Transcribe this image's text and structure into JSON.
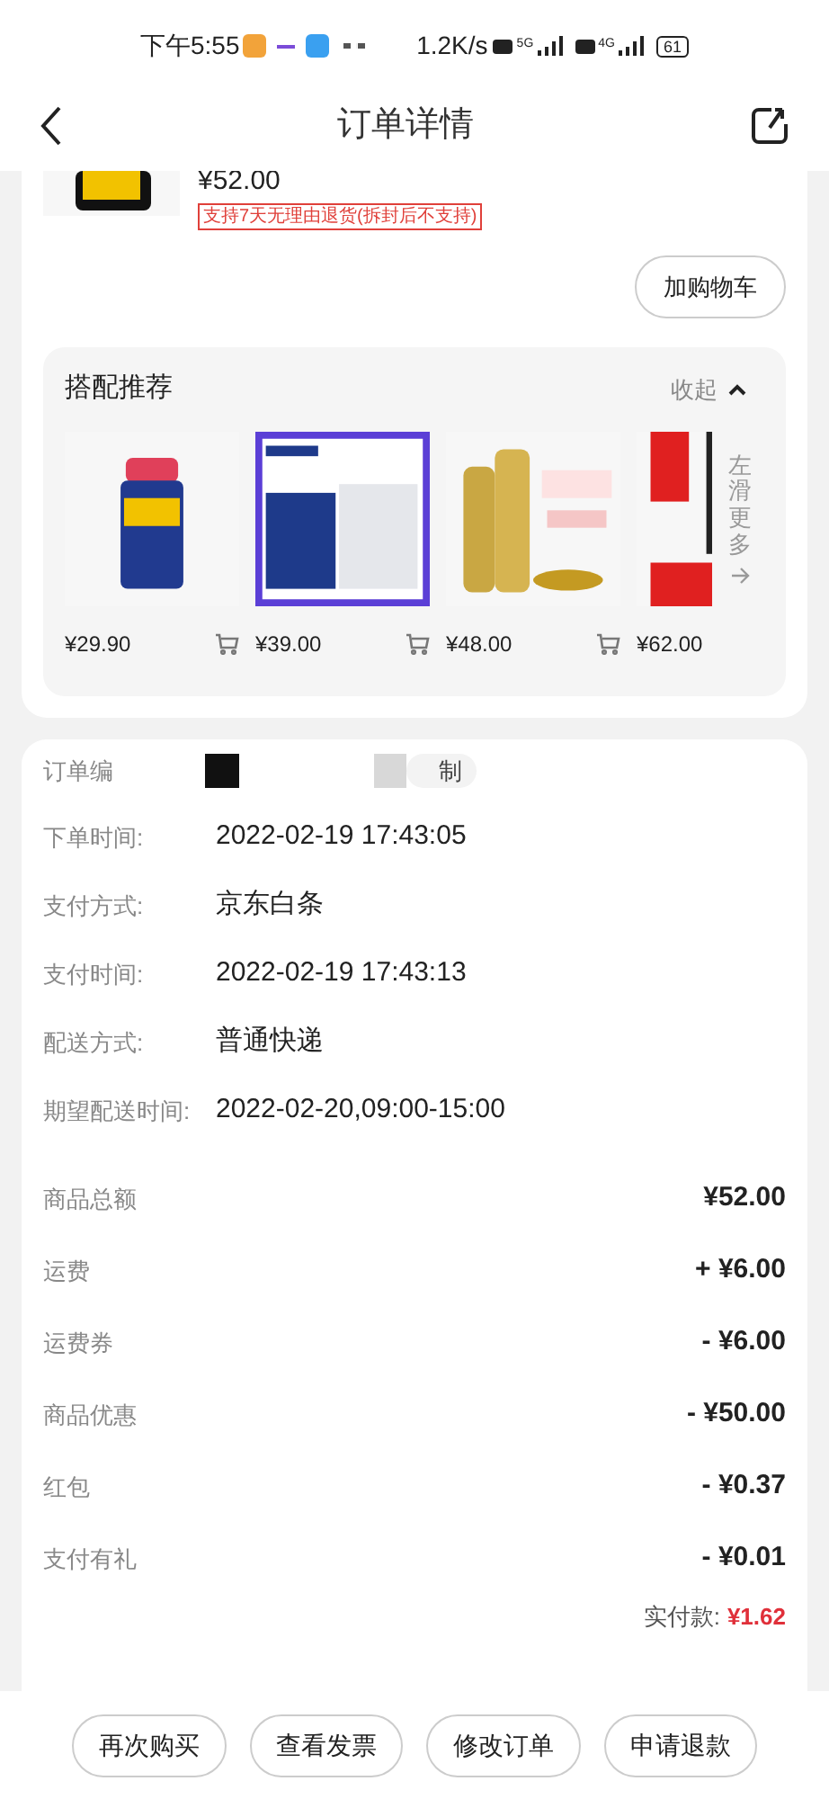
{
  "status_bar": {
    "time": "下午5:55",
    "speed": "1.2K/s",
    "network_1": "5G",
    "network_2": "4G",
    "battery": "61"
  },
  "header": {
    "title": "订单详情"
  },
  "product": {
    "price": "¥52.00",
    "return_policy": "支持7天无理由退货(拆封后不支持)",
    "add_to_cart": "加购物车"
  },
  "recommendations": {
    "title": "搭配推荐",
    "collapse": "收起",
    "more": "左滑更多",
    "items": [
      {
        "price": "¥29.90"
      },
      {
        "price": "¥39.00"
      },
      {
        "price": "¥48.00"
      },
      {
        "price": "¥62.00"
      }
    ]
  },
  "order_info": {
    "order_number_label": "订单编",
    "copy": "制",
    "rows": [
      {
        "label": "下单时间:",
        "value": "2022-02-19 17:43:05"
      },
      {
        "label": "支付方式:",
        "value": "京东白条"
      },
      {
        "label": "支付时间:",
        "value": "2022-02-19 17:43:13"
      },
      {
        "label": "配送方式:",
        "value": "普通快递"
      },
      {
        "label": "期望配送时间:",
        "value": "2022-02-20,09:00-15:00"
      }
    ]
  },
  "amounts": [
    {
      "label": "商品总额",
      "value": "¥52.00"
    },
    {
      "label": "运费",
      "value": "+ ¥6.00"
    },
    {
      "label": "运费券",
      "value": "- ¥6.00"
    },
    {
      "label": "商品优惠",
      "value": "- ¥50.00"
    },
    {
      "label": "红包",
      "value": "- ¥0.37"
    },
    {
      "label": "支付有礼",
      "value": "- ¥0.01"
    }
  ],
  "total": {
    "label": "实付款:",
    "value": "¥1.62"
  },
  "actions": [
    "再次购买",
    "查看发票",
    "修改订单",
    "申请退款"
  ]
}
